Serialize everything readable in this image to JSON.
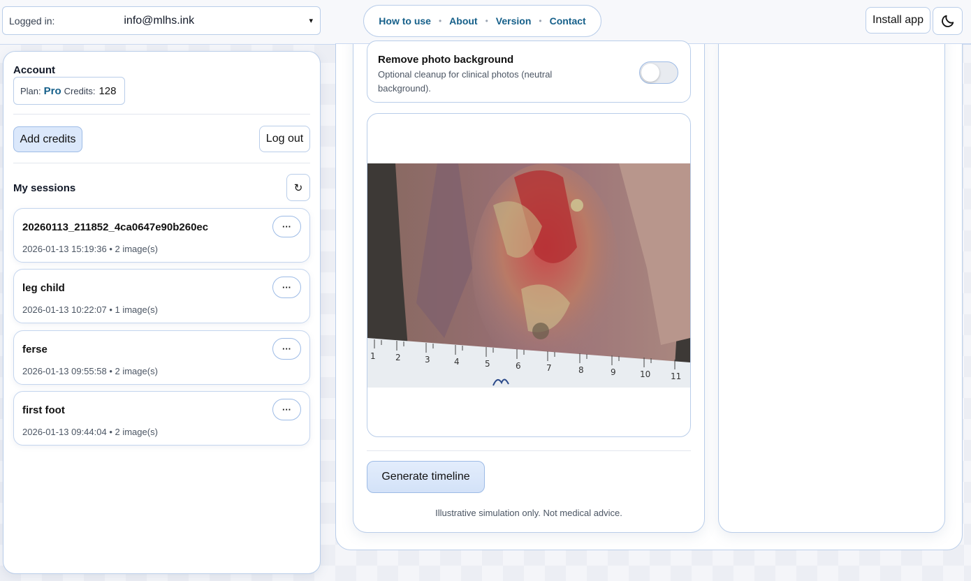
{
  "header": {
    "logged_in_label": "Logged in:",
    "email": "info@mlhs.ink",
    "caret": "▾",
    "nav": [
      {
        "label": "How to use"
      },
      {
        "label": "About"
      },
      {
        "label": "Version"
      },
      {
        "label": "Contact"
      }
    ],
    "nav_separator": "•",
    "install_label": "Install app",
    "theme_icon": "moon-icon"
  },
  "account": {
    "title": "Account",
    "plan_label": "Plan:",
    "plan_value": "Pro",
    "credits_label": "Credits:",
    "credits_value": "128",
    "add_credits_label": "Add credits",
    "logout_label": "Log out"
  },
  "sessions": {
    "title": "My sessions",
    "refresh_glyph": "↻",
    "menu_glyph": "···",
    "items": [
      {
        "name": "20260113_211852_4ca0647e90b260ec",
        "meta": "2026-01-13 15:19:36 • 2 image(s)"
      },
      {
        "name": "leg child",
        "meta": "2026-01-13 10:22:07 • 1 image(s)"
      },
      {
        "name": "ferse",
        "meta": "2026-01-13 09:55:58 • 2 image(s)"
      },
      {
        "name": "first foot",
        "meta": "2026-01-13 09:44:04 • 2 image(s)"
      }
    ]
  },
  "main": {
    "toggle_title": "Remove photo background",
    "toggle_desc": "Optional cleanup for clinical photos (neutral background).",
    "toggle_on": false,
    "generate_label": "Generate timeline",
    "disclaimer": "Illustrative simulation only. Not medical advice.",
    "ruler_numbers": [
      "1",
      "2",
      "3",
      "4",
      "5",
      "6",
      "7",
      "8",
      "9",
      "10",
      "11"
    ]
  },
  "colors": {
    "accent": "#16608a",
    "border": "#b9cde9",
    "primary_bg": "#dbe8fb"
  }
}
